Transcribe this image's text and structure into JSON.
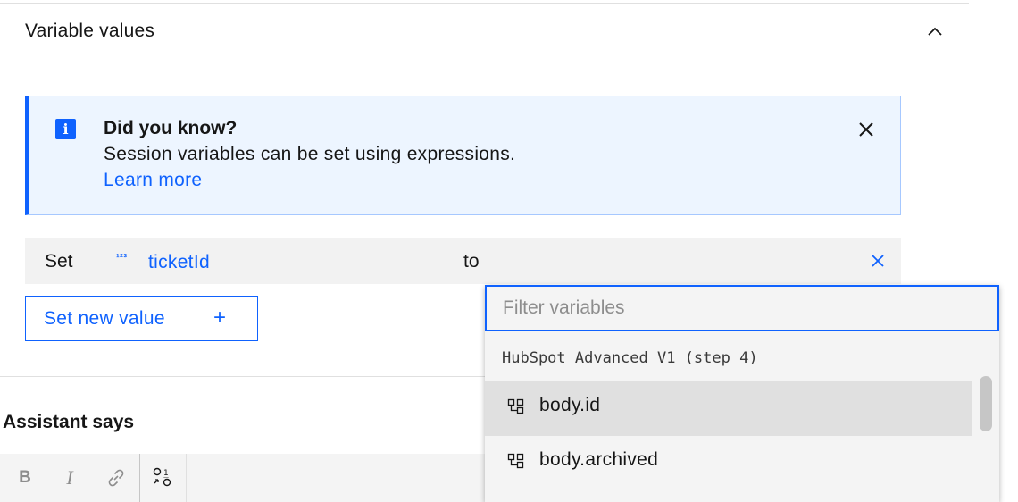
{
  "section": {
    "title": "Variable values",
    "collapse_icon": "chevron-up-icon"
  },
  "notification": {
    "icon": "info-icon",
    "icon_glyph": "i",
    "title": "Did you know?",
    "body": "Session variables can be set using expressions.",
    "link": "Learn more",
    "close_icon": "close-icon"
  },
  "set_row": {
    "set_label": "Set",
    "type_icon": "number-type-icon",
    "type_glyph": "¹²³",
    "variable": "ticketId",
    "to_label": "to",
    "remove_icon": "close-icon"
  },
  "new_value_button": {
    "label": "Set new value",
    "plus": "+"
  },
  "assistant": {
    "label": "Assistant says"
  },
  "toolbar": {
    "bold": "B",
    "italic": "I",
    "link_icon": "link-icon",
    "variable_icon": "insert-variable-icon"
  },
  "dropdown": {
    "filter_placeholder": "Filter variables",
    "filter_value": "",
    "group_label": "HubSpot Advanced V1 (step 4)",
    "items": [
      {
        "label": "body.id",
        "icon": "data-structure-icon",
        "hovered": true
      },
      {
        "label": "body.archived",
        "icon": "data-structure-icon",
        "hovered": false
      }
    ]
  },
  "colors": {
    "accent": "#0f62fe",
    "notification_bg": "#edf5ff",
    "row_bg": "#f2f2f2",
    "hover_bg": "#e0e0e0"
  }
}
